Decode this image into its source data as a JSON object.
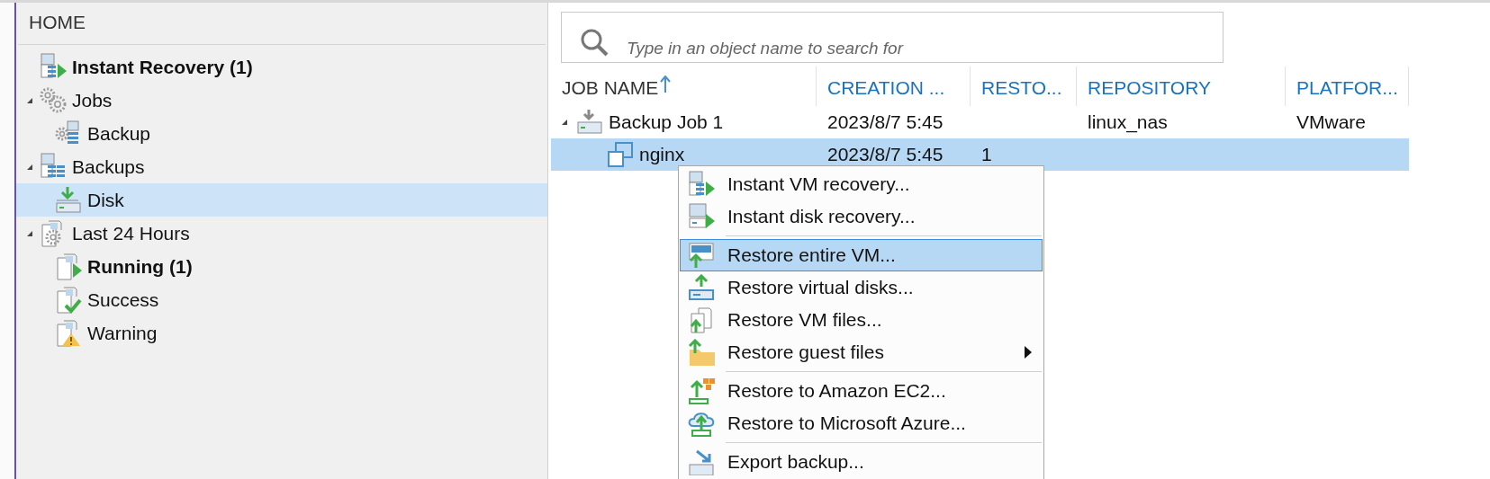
{
  "navigation": {
    "title": "HOME",
    "items": [
      {
        "label": "Instant Recovery (1)",
        "bold": true,
        "selected": false
      },
      {
        "label": "Jobs",
        "bold": false,
        "selected": false,
        "expanded": true,
        "children": [
          {
            "label": "Backup",
            "bold": false,
            "selected": false
          }
        ]
      },
      {
        "label": "Backups",
        "bold": false,
        "selected": false,
        "expanded": true,
        "children": [
          {
            "label": "Disk",
            "bold": false,
            "selected": true
          }
        ]
      },
      {
        "label": "Last 24 Hours",
        "bold": false,
        "selected": false,
        "expanded": true,
        "children": [
          {
            "label": "Running (1)",
            "bold": true,
            "selected": false
          },
          {
            "label": "Success",
            "bold": false,
            "selected": false
          },
          {
            "label": "Warning",
            "bold": false,
            "selected": false
          }
        ]
      }
    ]
  },
  "search": {
    "placeholder": "Type in an object name to search for"
  },
  "table": {
    "columns": [
      {
        "label": "JOB NAME",
        "sorted": true
      },
      {
        "label": "CREATION ...",
        "sorted": false
      },
      {
        "label": "RESTO...",
        "sorted": false
      },
      {
        "label": "REPOSITORY",
        "sorted": false
      },
      {
        "label": "PLATFOR...",
        "sorted": false
      }
    ],
    "rows": [
      {
        "cells": [
          "Backup Job 1",
          "2023/8/7 5:45",
          "",
          "linux_nas",
          "VMware"
        ],
        "selected": false,
        "expanded": true,
        "children": [
          {
            "cells": [
              "nginx",
              "2023/8/7 5:45",
              "1",
              "",
              ""
            ],
            "selected": true
          }
        ]
      }
    ]
  },
  "context_menu": {
    "groups": [
      [
        {
          "label": "Instant VM recovery...",
          "selected": false,
          "submenu": false
        },
        {
          "label": "Instant disk recovery...",
          "selected": false,
          "submenu": false
        }
      ],
      [
        {
          "label": "Restore entire VM...",
          "selected": true,
          "submenu": false
        },
        {
          "label": "Restore virtual disks...",
          "selected": false,
          "submenu": false
        },
        {
          "label": "Restore VM files...",
          "selected": false,
          "submenu": false
        },
        {
          "label": "Restore guest files",
          "selected": false,
          "submenu": true
        }
      ],
      [
        {
          "label": "Restore to Amazon EC2...",
          "selected": false,
          "submenu": false
        },
        {
          "label": "Restore to Microsoft Azure...",
          "selected": false,
          "submenu": false
        }
      ],
      [
        {
          "label": "Export backup...",
          "selected": false,
          "submenu": false
        }
      ]
    ]
  }
}
